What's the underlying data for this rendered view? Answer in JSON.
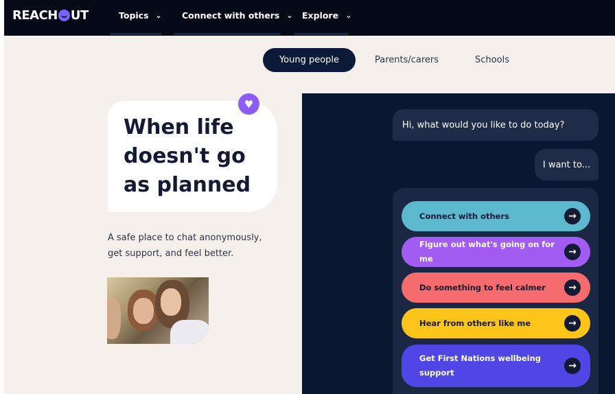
{
  "nav": {
    "logo_text_1": "REACH",
    "logo_text_2": "UT",
    "items": [
      {
        "label": "Topics",
        "chevron": "⌄"
      },
      {
        "label": "Connect with others",
        "chevron": "⌄"
      },
      {
        "label": "Explore",
        "chevron": "⌄"
      }
    ]
  },
  "audience_tabs": [
    {
      "label": "Young people",
      "active": true
    },
    {
      "label": "Parents/carers",
      "active": false
    },
    {
      "label": "Schools",
      "active": false
    }
  ],
  "hero": {
    "title_line_1": "When life",
    "title_line_2": "doesn't go",
    "title_line_3": "as planned",
    "subtitle_line_1": "A safe place to chat anonymously,",
    "subtitle_line_2": "get support, and feel better.",
    "heart_icon": "heart-icon"
  },
  "chat": {
    "bot_message": "Hi, what would you like to do today?",
    "user_message": "I want to...",
    "options": [
      {
        "label_line_1": "Connect with others",
        "label_line_2": "",
        "color": "#5bb8cf"
      },
      {
        "label_line_1": "Figure out what's going on for me",
        "label_line_2": "",
        "color": "#a25cf2"
      },
      {
        "label_line_1": "Do something to feel calmer",
        "label_line_2": "",
        "color": "#f56b6e"
      },
      {
        "label_line_1": "Hear from others like me",
        "label_line_2": "",
        "color": "#fdc419"
      },
      {
        "label_line_1": "Get First Nations wellbeing",
        "label_line_2": "support",
        "color": "#4f46e5"
      }
    ],
    "arrow_icon": "arrow-right-icon"
  },
  "colors": {
    "nav_bg": "#050b16",
    "cream_bg": "#f5f0eb",
    "panel_bg": "#0a1730",
    "active_tab": "#0c1a38",
    "brand_purple": "#8c5cf5"
  }
}
